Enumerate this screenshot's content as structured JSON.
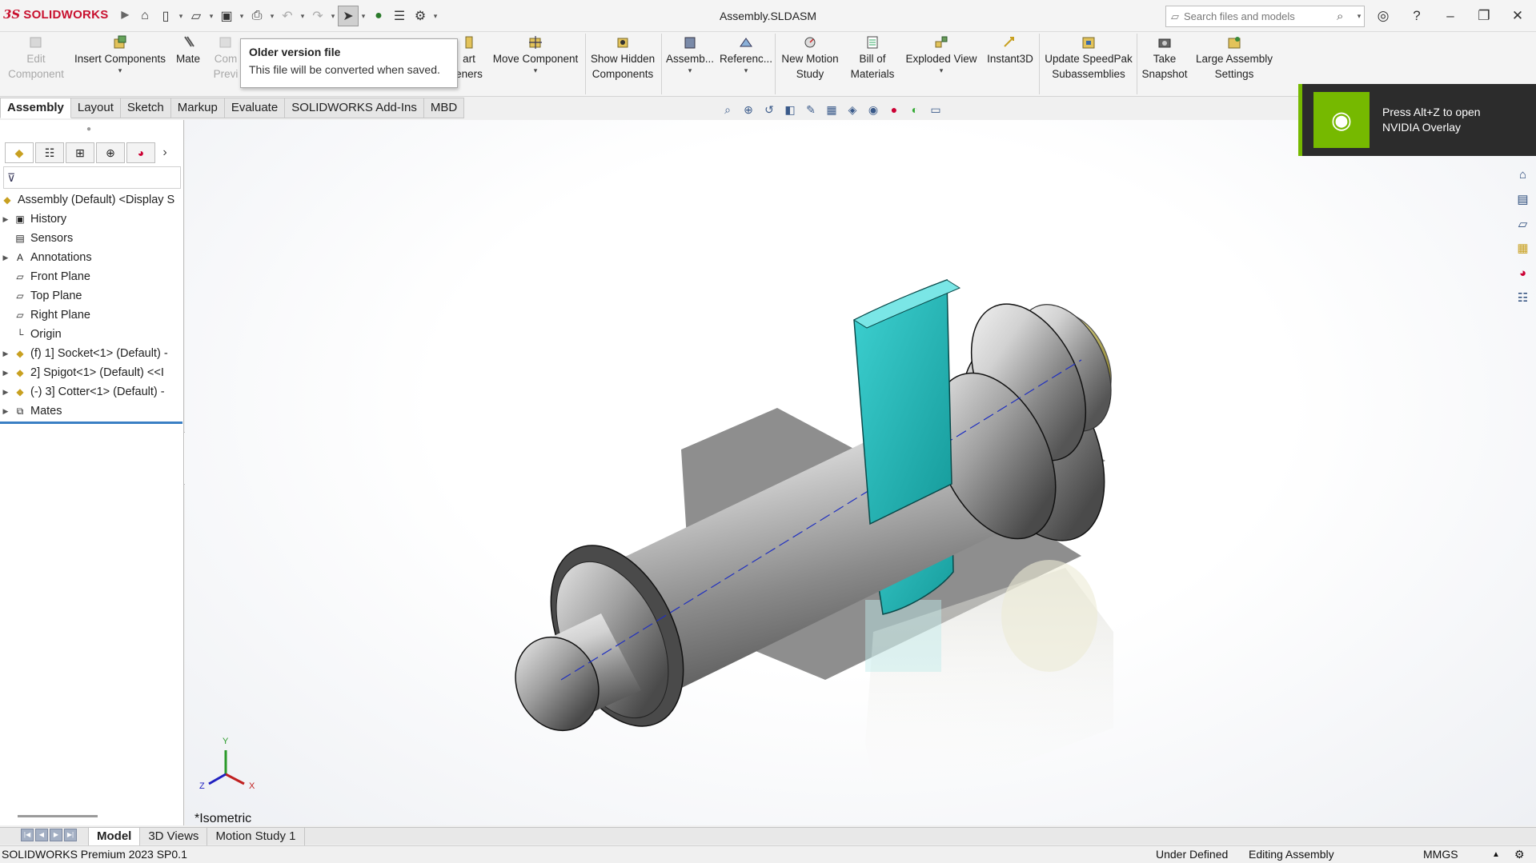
{
  "window": {
    "title": "Assembly.SLDASM",
    "brand": "SOLIDWORKS",
    "search_placeholder": "Search files and models"
  },
  "ribbon": {
    "buttons": [
      {
        "id": "edit-component",
        "label1": "Edit",
        "label2": "Component",
        "disabled": true
      },
      {
        "id": "insert-components",
        "label1": "Insert Components",
        "label2": ""
      },
      {
        "id": "mate",
        "label1": "Mate",
        "label2": ""
      },
      {
        "id": "component-preview",
        "label1": "Com",
        "label2": "Previ",
        "disabled": true
      },
      {
        "id": "smart-fasteners",
        "label1": "art",
        "label2": "eners"
      },
      {
        "id": "move-component",
        "label1": "Move Component",
        "label2": ""
      },
      {
        "id": "show-hidden",
        "label1": "Show Hidden",
        "label2": "Components"
      },
      {
        "id": "assembly-features",
        "label1": "Assemb...",
        "label2": ""
      },
      {
        "id": "reference-geometry",
        "label1": "Referenc...",
        "label2": ""
      },
      {
        "id": "new-motion-study",
        "label1": "New Motion",
        "label2": "Study"
      },
      {
        "id": "bill-of-materials",
        "label1": "Bill of",
        "label2": "Materials"
      },
      {
        "id": "exploded-view",
        "label1": "Exploded View",
        "label2": ""
      },
      {
        "id": "instant3d",
        "label1": "Instant3D",
        "label2": ""
      },
      {
        "id": "update-speedpak",
        "label1": "Update SpeedPak",
        "label2": "Subassemblies"
      },
      {
        "id": "take-snapshot",
        "label1": "Take",
        "label2": "Snapshot"
      },
      {
        "id": "large-assembly",
        "label1": "Large Assembly",
        "label2": "Settings"
      }
    ]
  },
  "tooltip": {
    "title": "Older version file",
    "body": "This file will be converted when saved."
  },
  "tabs": [
    "Assembly",
    "Layout",
    "Sketch",
    "Markup",
    "Evaluate",
    "SOLIDWORKS Add-Ins",
    "MBD"
  ],
  "tree": {
    "root": "Assembly (Default) <Display S",
    "items": [
      {
        "label": "History",
        "expandable": true,
        "icon": "history-icon"
      },
      {
        "label": "Sensors",
        "expandable": false,
        "icon": "sensor-icon"
      },
      {
        "label": "Annotations",
        "expandable": true,
        "icon": "annotation-icon"
      },
      {
        "label": "Front Plane",
        "expandable": false,
        "icon": "plane-icon"
      },
      {
        "label": "Top Plane",
        "expandable": false,
        "icon": "plane-icon"
      },
      {
        "label": "Right Plane",
        "expandable": false,
        "icon": "plane-icon"
      },
      {
        "label": "Origin",
        "expandable": false,
        "icon": "origin-icon"
      },
      {
        "label": "(f) 1] Socket<1> (Default) -",
        "expandable": true,
        "icon": "part-icon"
      },
      {
        "label": "2] Spigot<1> (Default) <<I",
        "expandable": true,
        "icon": "part-icon"
      },
      {
        "label": "(-) 3] Cotter<1> (Default) -",
        "expandable": true,
        "icon": "part-icon"
      },
      {
        "label": "Mates",
        "expandable": true,
        "icon": "mates-icon"
      }
    ]
  },
  "viewport": {
    "view_label": "*Isometric",
    "triad": {
      "x": "X",
      "y": "Y",
      "z": "Z"
    }
  },
  "nvidia": {
    "text": "Press Alt+Z to open NVIDIA Overlay"
  },
  "bottom_tabs": [
    "Model",
    "3D Views",
    "Motion Study 1"
  ],
  "status": {
    "product": "SOLIDWORKS Premium 2023 SP0.1",
    "state": "Under Defined",
    "mode": "Editing Assembly",
    "units": "MMGS"
  },
  "colors": {
    "cotter": "#1fb8b8",
    "socket": "#b8b8b8",
    "spigot": "#d9d48a",
    "nvidia_green": "#76b900",
    "brand_red": "#c8102e"
  }
}
